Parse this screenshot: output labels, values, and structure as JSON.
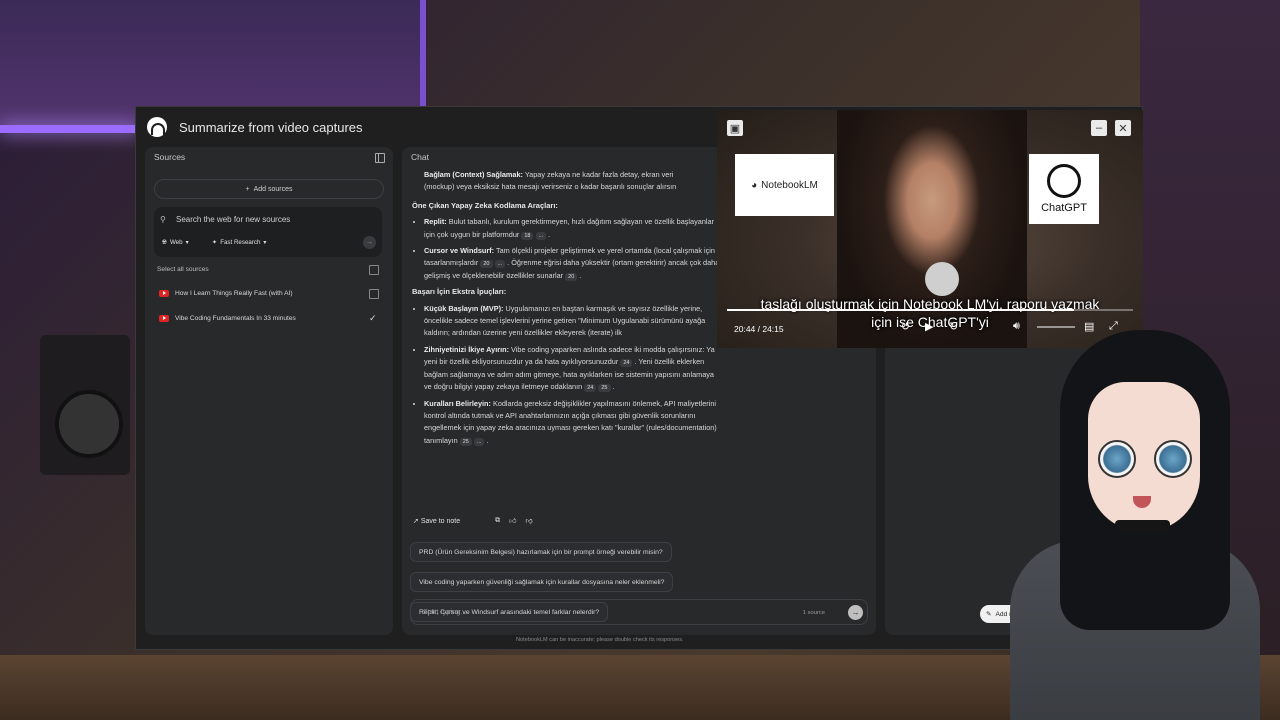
{
  "app": {
    "title": "Summarize from video captures"
  },
  "sources": {
    "heading": "Sources",
    "add_label": "Add sources",
    "search_placeholder": "Search the web for new sources",
    "chip_web": "Web",
    "chip_fast": "Fast Research",
    "select_all": "Select all sources",
    "items": [
      {
        "title": "How I Learn Things Really Fast (with AI)",
        "checked": false
      },
      {
        "title": "Vibe Coding Fundamentals In 33 minutes",
        "checked": true
      }
    ]
  },
  "chat": {
    "heading": "Chat",
    "top_b": "Bağlam (Context) Sağlamak:",
    "top_text": " Yapay zekaya ne kadar fazla detay, ekran veri",
    "top_line2": "(mockup) veya eksiksiz hata mesajı verirseniz o kadar başarılı sonuçlar alırsın",
    "section1": "Öne Çıkan Yapay Zeka Kodlama Araçları:",
    "replit_b": "Replit:",
    "replit_text": " Bulut tabanlı, kurulum gerektirmeyen, hızlı dağıtım sağlayan ve özellik başlayanlar için çok uygun bir platformdur ",
    "cite18": "18",
    "cursor_b": "Cursor ve Windsurf:",
    "cursor_text": " Tam ölçekli projeler geliştirmek ve yerel ortamda (local çalışmak için tasarlanmışlardır ",
    "cite20": "20",
    "cursor_text2": " . Öğrenme eğrisi daha yüksektir (ortam gerektirir) ancak çok daha gelişmiş ve ölçeklenebilir özellikler sunarlar ",
    "section2": "Başarı İçin Ekstra İpuçları:",
    "mvp_b": "Küçük Başlayın (MVP):",
    "mvp_text": " Uygulamanızı en baştan karmaşık ve sayısız özellikle yerine, öncelikle sadece temel işlevlerini yerine getiren \"Minimum Uygulanabi sürümünü ayağa kaldırın; ardından üzerine yeni özellikler ekleyerek (iterate) ilk",
    "mind_b": "Zihniyetinizi İkiye Ayırın:",
    "mind_text": " Vibe coding yaparken aslında sadece iki modda çalışırsınız: Ya yeni bir özellik ekliyorsunuzdur ya da hata ayıklıyorsunuzdur ",
    "cite24": "24",
    "mind_text2": " . Yeni özellik eklerken bağlam sağlamaya ve adım adım gitmeye, hata ayıklarken ise sistemin yapısını anlamaya ve doğru bilgiyi yapay zekaya iletmeye odaklanın ",
    "cite25": "25",
    "rules_b": "Kuralları Belirleyin:",
    "rules_text": " Kodlarda gereksiz değişiklikler yapılmasını önlemek, API maliyetlerini kontrol altında tutmak ve API anahtarlarınızın açığa çıkması gibi güvenlik sorunlarını engellemek için yapay zeka aracınıza uyması gereken katı \"kurallar\" (rules/documentation) tanımlayın ",
    "ellipsis": "...",
    "save_note": "Save to note",
    "suggestions": [
      "PRD (Ürün Gereksinim Belgesi) hazırlamak için bir prompt örneği verebilir misin?",
      "Vibe coding yaparken güvenliği sağlamak için kurallar dosyasına neler eklenmeli?",
      "Replit, Cursor ve Windsurf arasındaki temel farklar nelerdir?"
    ],
    "input_placeholder": "Start typing...",
    "source_count": "1 source",
    "disclaimer": "NotebookLM can be inaccurate; please double check its responses."
  },
  "studio": {
    "add_note": "Add n"
  },
  "video": {
    "logo_nlm": "NotebookLM",
    "logo_gpt": "ChatGPT",
    "caption_line1": "taslağı oluşturmak için Notebook LM'yi, raporu yazmak",
    "caption_line2": "için ise ChatGPT'yi",
    "time": "20:44 / 24:15",
    "progress": 0.855
  }
}
